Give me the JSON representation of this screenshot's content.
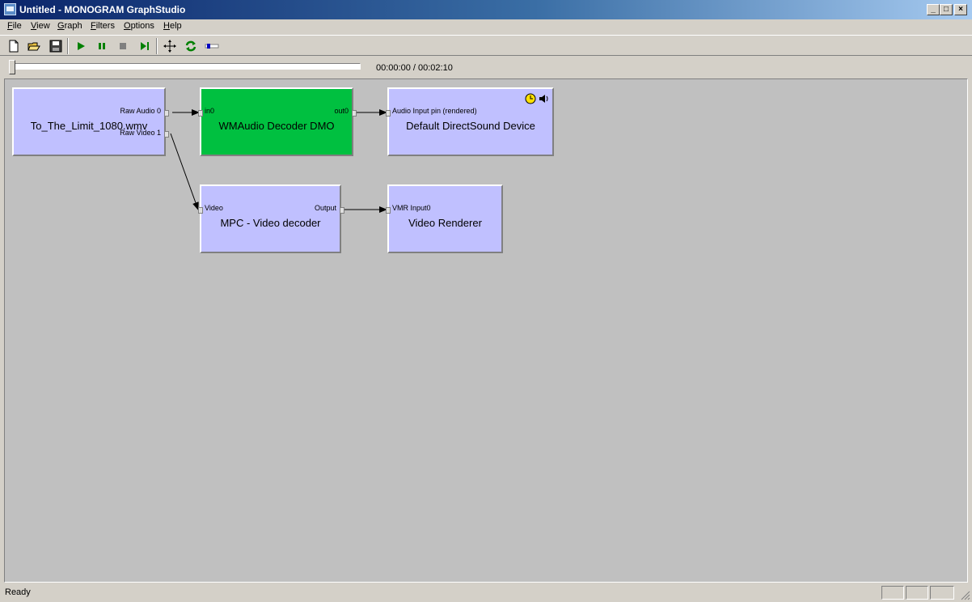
{
  "window": {
    "title": "Untitled - MONOGRAM GraphStudio",
    "minimize": "_",
    "maximize": "□",
    "close": "×"
  },
  "menu": [
    "File",
    "View",
    "Graph",
    "Filters",
    "Options",
    "Help"
  ],
  "toolbar": {
    "icons": [
      "new-icon",
      "open-icon",
      "save-icon",
      "play-icon",
      "pause-icon",
      "stop-icon",
      "step-icon",
      "arrange-icon",
      "refresh-icon",
      "seek-icon"
    ],
    "accent": "#008000"
  },
  "seek": {
    "position": 0,
    "time": "00:00:00 / 00:02:10"
  },
  "graph": {
    "filters": {
      "source": {
        "name": "To_The_Limit_1080.wmv",
        "out_pins": [
          "Raw Audio 0",
          "Raw Video 1"
        ]
      },
      "audio_decoder": {
        "name": "WMAudio Decoder DMO",
        "in_pin": "in0",
        "out_pin": "out0",
        "color": "#00c040"
      },
      "audio_renderer": {
        "name": "Default DirectSound Device",
        "in_pin": "Audio Input pin (rendered)",
        "icons": [
          "clock-icon",
          "speaker-icon"
        ]
      },
      "video_decoder": {
        "name": "MPC - Video decoder",
        "in_pin": "Video",
        "out_pin": "Output"
      },
      "video_renderer": {
        "name": "Video Renderer",
        "in_pin": "VMR Input0"
      }
    },
    "filter_color": "#c0c0ff"
  },
  "status": {
    "text": "Ready"
  }
}
